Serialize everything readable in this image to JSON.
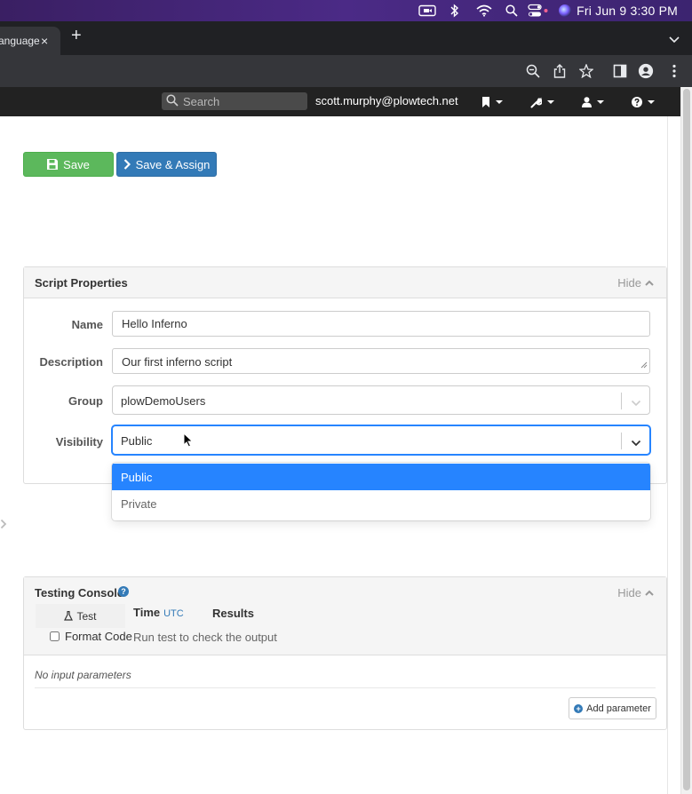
{
  "menubar": {
    "clock": "Fri Jun 9  3:30 PM",
    "icons": [
      "video-camera-icon",
      "bluetooth-icon",
      "wifi-icon",
      "spotlight-search-icon",
      "control-center-icon",
      "siri-icon"
    ]
  },
  "browser": {
    "tab": {
      "label": "anguage",
      "close": "×"
    },
    "new_tab": "+",
    "toolbar_icons": [
      "zoom-icon",
      "share-icon",
      "bookmark-star-icon",
      "sidebar-icon",
      "profile-icon",
      "more-icon"
    ]
  },
  "navbar": {
    "search_placeholder": "Search",
    "user_email": "scott.murphy@plowtech.net",
    "menus": [
      "bookmark-icon",
      "wrench-icon",
      "user-icon",
      "question-icon"
    ]
  },
  "actions": {
    "save_label": "Save",
    "save_assign_label": "Save & Assign"
  },
  "script_properties": {
    "title": "Script Properties",
    "hide_label": "Hide",
    "name_label": "Name",
    "name_value": "Hello Inferno",
    "description_label": "Description",
    "description_value": "Our first inferno script",
    "group_label": "Group",
    "group_value": "plowDemoUsers",
    "visibility_label": "Visibility",
    "visibility_value": "Public",
    "visibility_options": [
      "Public",
      "Private"
    ]
  },
  "testing_console": {
    "title": "Testing Console",
    "hide_label": "Hide",
    "test_tab": "Test",
    "time_label": "Time",
    "time_zone": "UTC",
    "results_label": "Results",
    "format_code_label": "Format Code",
    "run_hint": "Run test to check the output",
    "no_params": "No input parameters",
    "add_param_label": "Add parameter"
  },
  "colors": {
    "save_green": "#5cb85c",
    "primary_blue": "#337ab7",
    "select_focus": "#2684ff",
    "navbar_bg": "#222222"
  }
}
